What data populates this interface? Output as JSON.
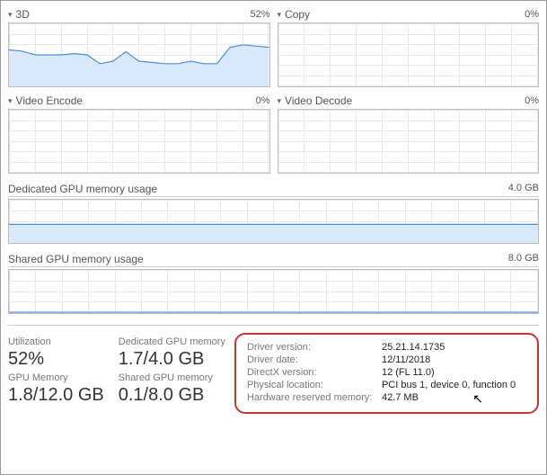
{
  "panels": {
    "p3d": {
      "label": "3D",
      "pct": "52%"
    },
    "copy": {
      "label": "Copy",
      "pct": "0%"
    },
    "venc": {
      "label": "Video Encode",
      "pct": "0%"
    },
    "vdec": {
      "label": "Video Decode",
      "pct": "0%"
    }
  },
  "wide": {
    "dedicated": {
      "label": "Dedicated GPU memory usage",
      "max": "4.0 GB"
    },
    "shared": {
      "label": "Shared GPU memory usage",
      "max": "8.0 GB"
    }
  },
  "stats": {
    "utilization": {
      "label": "Utilization",
      "value": "52%"
    },
    "gpumem": {
      "label": "GPU Memory",
      "value": "1.8/12.0 GB"
    },
    "dedicated": {
      "label": "Dedicated GPU memory",
      "value": "1.7/4.0 GB"
    },
    "shared": {
      "label": "Shared GPU memory",
      "value": "0.1/8.0 GB"
    }
  },
  "details": {
    "driver_version": {
      "label": "Driver version:",
      "value": "25.21.14.1735"
    },
    "driver_date": {
      "label": "Driver date:",
      "value": "12/11/2018"
    },
    "directx": {
      "label": "DirectX version:",
      "value": "12 (FL 11.0)"
    },
    "location": {
      "label": "Physical location:",
      "value": "PCI bus 1, device 0, function 0"
    },
    "reserved": {
      "label": "Hardware reserved memory:",
      "value": "42.7 MB"
    }
  },
  "chart_data": [
    {
      "type": "line",
      "title": "3D",
      "ylim": [
        0,
        100
      ],
      "x": [
        0,
        5,
        10,
        15,
        20,
        25,
        30,
        35,
        40,
        45,
        50,
        55,
        60,
        65,
        70,
        75,
        80,
        85,
        90,
        95,
        100
      ],
      "values": [
        58,
        56,
        50,
        50,
        50,
        52,
        50,
        36,
        40,
        55,
        40,
        38,
        36,
        36,
        40,
        36,
        36,
        62,
        66,
        64,
        62
      ]
    },
    {
      "type": "line",
      "title": "Copy",
      "ylim": [
        0,
        100
      ],
      "values": [
        0
      ]
    },
    {
      "type": "line",
      "title": "Video Encode",
      "ylim": [
        0,
        100
      ],
      "values": [
        0
      ]
    },
    {
      "type": "line",
      "title": "Video Decode",
      "ylim": [
        0,
        100
      ],
      "values": [
        0
      ]
    },
    {
      "type": "area",
      "title": "Dedicated GPU memory usage",
      "ylim": [
        0,
        4.0
      ],
      "values": [
        1.7
      ]
    },
    {
      "type": "area",
      "title": "Shared GPU memory usage",
      "ylim": [
        0,
        8.0
      ],
      "values": [
        0.1
      ]
    }
  ]
}
